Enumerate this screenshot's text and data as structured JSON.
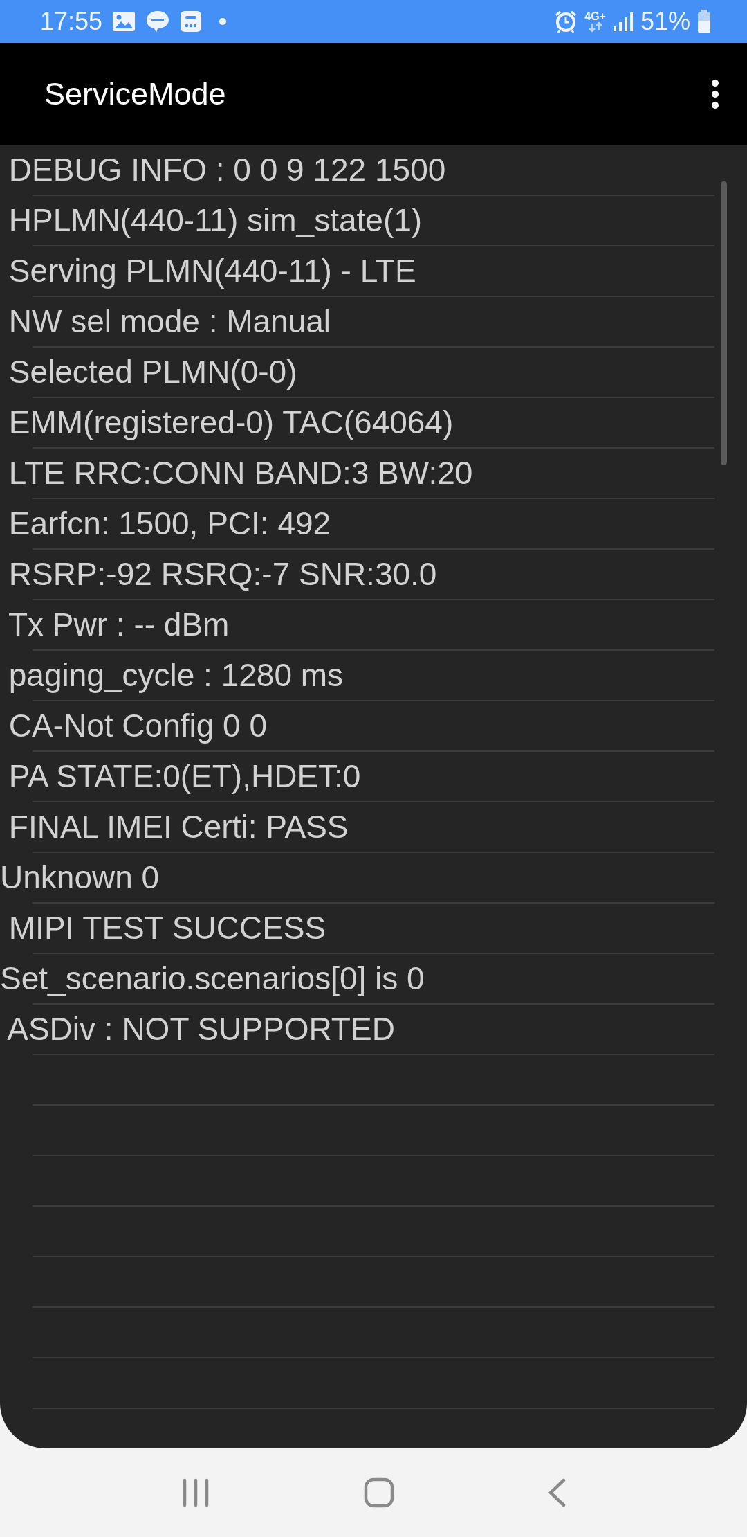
{
  "status_bar": {
    "time": "17:55",
    "network": "4G+",
    "battery": "51%"
  },
  "app_bar": {
    "title": "ServiceMode"
  },
  "lines": [
    " DEBUG INFO : 0 0 9 122 1500",
    " HPLMN(440-11) sim_state(1)",
    " Serving PLMN(440-11) - LTE",
    " NW sel mode : Manual",
    " Selected PLMN(0-0)",
    " EMM(registered-0) TAC(64064)",
    " LTE RRC:CONN BAND:3 BW:20",
    " Earfcn: 1500, PCI: 492",
    " RSRP:-92 RSRQ:-7 SNR:30.0",
    " Tx Pwr : -- dBm",
    " paging_cycle : 1280 ms",
    " CA-Not Config 0 0",
    " PA STATE:0(ET),HDET:0",
    " FINAL IMEI Certi: PASS",
    "Unknown 0",
    " MIPI TEST SUCCESS",
    "Set_scenario.scenarios[0] is 0",
    " ASDiv : NOT SUPPORTED"
  ]
}
